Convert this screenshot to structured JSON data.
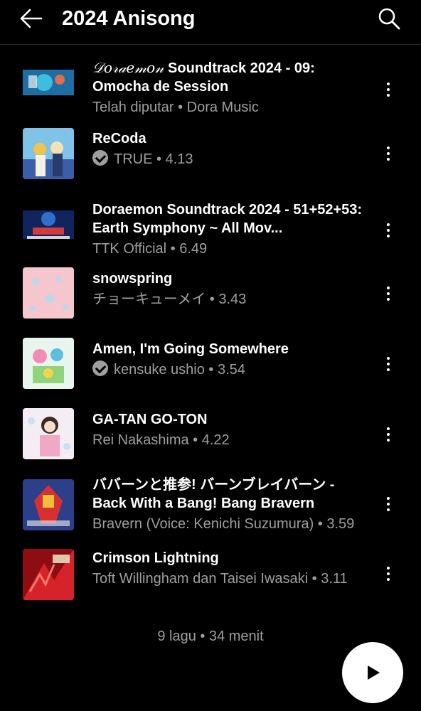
{
  "header": {
    "title": "2024 Anisong"
  },
  "songs": [
    {
      "title_deco": "𝒟𝑜𝓇𝒶𝑒𝓂𝑜𝓃",
      "title": " Soundtrack 2024 - 09: Omocha de Session",
      "subtitle": "Telah diputar • Dora Music",
      "verified": false,
      "thumb_colors": [
        "#1d6fa3",
        "#3fbde0",
        "#e86a4a"
      ]
    },
    {
      "title": "ReCoda",
      "subtitle": "TRUE • 4.13",
      "verified": true,
      "thumb_colors": [
        "#7fc3e8",
        "#f2c24a",
        "#3b5ea8"
      ]
    },
    {
      "title": "Doraemon Soundtrack 2024 - 51+52+53: Earth Symphony ~ All Mov...",
      "subtitle": "TTK Official • 6.49",
      "verified": false,
      "thumb_colors": [
        "#10245e",
        "#2e6fd0",
        "#d33a3a"
      ]
    },
    {
      "title": "snowspring",
      "subtitle": "チョーキューメイ • 3.43",
      "verified": false,
      "thumb_colors": [
        "#f6c6cf",
        "#f9d8de",
        "#b9d9ef"
      ]
    },
    {
      "title": "Amen, I'm Going Somewhere",
      "subtitle": "kensuke ushio • 3.54",
      "verified": true,
      "thumb_colors": [
        "#e8f4ee",
        "#f28bb5",
        "#5bbfe0"
      ]
    },
    {
      "title": "GA-TAN GO-TON",
      "subtitle": "Rei Nakashima • 4.22",
      "verified": false,
      "thumb_colors": [
        "#f4eef4",
        "#f0a9c4",
        "#c7e2f3"
      ]
    },
    {
      "title": "ババーンと推参! バーンブレイバーン - Back With a Bang! Bang Bravern",
      "subtitle": "Bravern (Voice: Kenichi Suzumura) • 3.59",
      "verified": false,
      "thumb_colors": [
        "#2b3f8a",
        "#d83030",
        "#e8c23a"
      ]
    },
    {
      "title": "Crimson Lightning",
      "subtitle": "Toft Willingham dan Taisei Iwasaki • 3.11",
      "verified": false,
      "thumb_colors": [
        "#8e0d12",
        "#d6232a",
        "#f07a6a"
      ]
    }
  ],
  "footer": {
    "summary": "9 lagu • 34 menit"
  },
  "icons": {
    "back": "arrow-left-icon",
    "search": "search-icon",
    "more": "more-vertical-icon",
    "play": "play-icon"
  }
}
